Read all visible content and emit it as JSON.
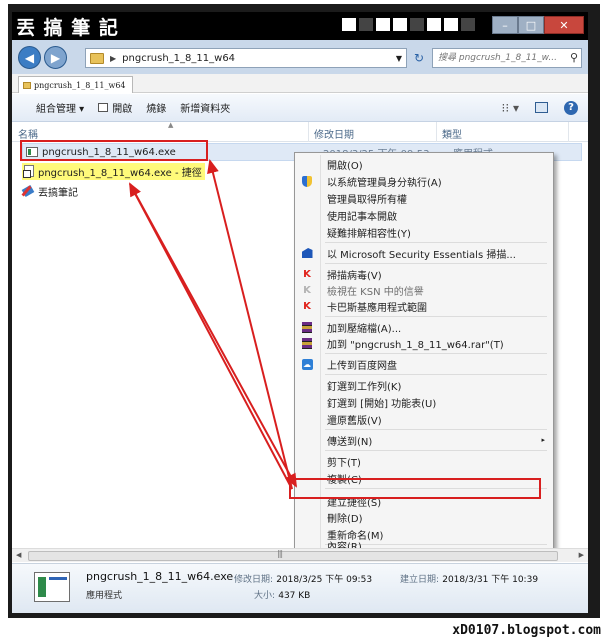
{
  "window": {
    "logo_text": "丟 搞 筆 記",
    "buttons": {
      "minimize": "–",
      "maximize": "□",
      "close": "✕"
    }
  },
  "address": {
    "path": "pngcrush_1_8_11_w64",
    "search_placeholder": "搜尋 pngcrush_1_8_11_w...",
    "icons": {
      "back": "◀",
      "forward": "▶",
      "refresh": "↻",
      "search": "⚲"
    }
  },
  "tab": {
    "label": "pngcrush_1_8_11_w64"
  },
  "toolbar": {
    "organize": "組合管理 ▾",
    "open": "開啟",
    "burn": "燒錄",
    "new_folder": "新增資料夾",
    "views_glyph": "⁝⁝ ▾",
    "help": "?"
  },
  "columns": {
    "name": "名稱",
    "date_modified": "修改日期",
    "type": "類型"
  },
  "files": [
    {
      "name": "pngcrush_1_8_11_w64.exe",
      "date": "2018/3/25 下午 09:53",
      "type": "應用程式"
    },
    {
      "name": "pngcrush_1_8_11_w64.exe - 捷徑"
    },
    {
      "name": "丟搞筆記"
    }
  ],
  "context_menu": {
    "items": [
      "開啟(O)",
      "以系統管理員身分執行(A)",
      "管理員取得所有權",
      "使用記事本開啟",
      "疑難排解相容性(Y)",
      "以 Microsoft Security Essentials 掃描...",
      "掃描病毒(V)",
      "檢視在 KSN 中的信譽",
      "卡巴斯基應用程式範圍",
      "加到壓縮檔(A)...",
      "加到 \"pngcrush_1_8_11_w64.rar\"(T)",
      "上传到百度网盘",
      "釘選到工作列(K)",
      "釘選到 [開始] 功能表(U)",
      "還原舊版(V)",
      "傳送到(N)",
      "剪下(T)",
      "複製(C)",
      "建立捷徑(S)",
      "刪除(D)",
      "重新命名(M)",
      "內容(R)"
    ],
    "submenu_arrow": "▸"
  },
  "details": {
    "name": "pngcrush_1_8_11_w64.exe",
    "type": "應用程式",
    "modified_label": "修改日期:",
    "modified_value": "2018/3/25 下午 09:53",
    "created_label": "建立日期:",
    "created_value": "2018/3/31 下午 10:39",
    "size_label": "大小:",
    "size_value": "437 KB"
  },
  "scrollbar": {
    "grip": "|||"
  },
  "watermark": "xD0107.blogspot.com",
  "colors": {
    "annotation_red": "#d81f1f",
    "highlight_yellow": "#fffa7a",
    "selection_blue": "#dfe9f6"
  }
}
